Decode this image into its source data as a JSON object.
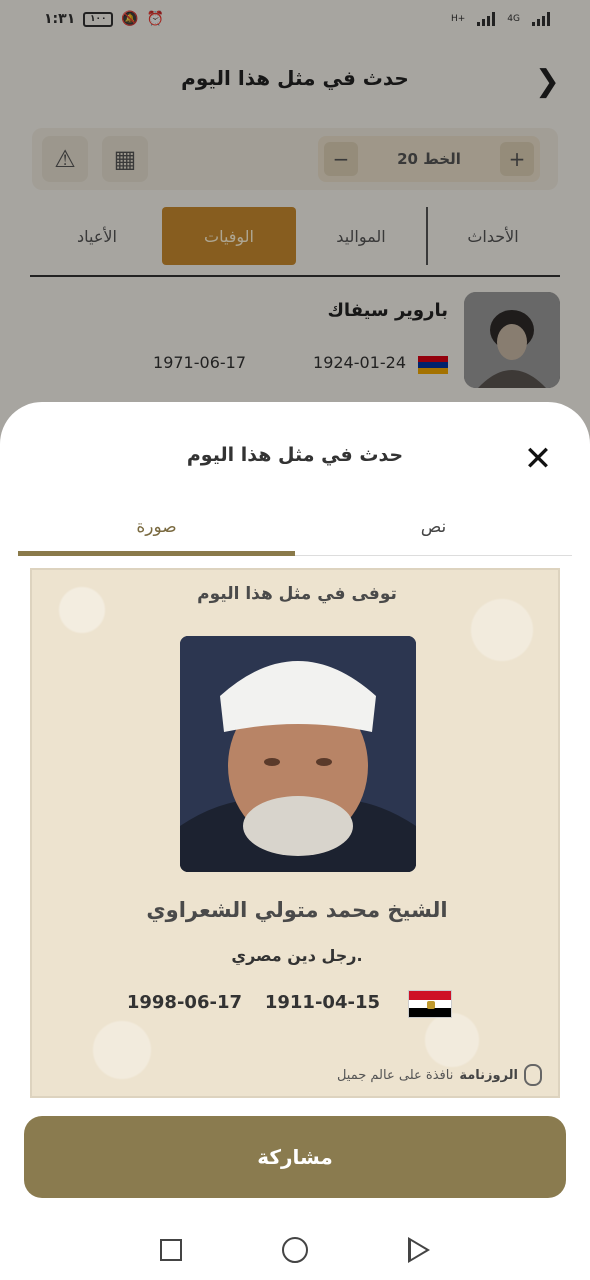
{
  "status_bar": {
    "time": "١:٣١",
    "battery": "١٠٠",
    "network": "4G",
    "network2": "H+"
  },
  "header": {
    "title": "حدث في مثل هذا اليوم"
  },
  "toolbar": {
    "font_label": "الخط 20",
    "plus": "+",
    "minus": "−"
  },
  "tabs": [
    {
      "label": "الأحداث"
    },
    {
      "label": "المواليد"
    },
    {
      "label": "الوفيات"
    },
    {
      "label": "الأعياد"
    }
  ],
  "person": {
    "name": "باروير سيفاك",
    "birth": "1924-01-24",
    "death": "1971-06-17"
  },
  "sheet": {
    "title": "حدث في مثل هذا اليوم",
    "close": "✕",
    "tabs": [
      {
        "label": "نص"
      },
      {
        "label": "صورة"
      }
    ]
  },
  "card": {
    "heading": "توفى في مثل هذا اليوم",
    "name": "الشيخ محمد متولي الشعراوي",
    "description": "رجل دين مصري.",
    "birth": "1911-04-15",
    "death": "1998-06-17",
    "brand_name": "الروزنامة",
    "brand_tagline": "نافذة على عالم جميل"
  },
  "share_button": {
    "label": "مشاركة"
  },
  "colors": {
    "accent": "#8a7b4f",
    "active_tab": "#c88a2e",
    "card_bg": "#ede3cf"
  }
}
